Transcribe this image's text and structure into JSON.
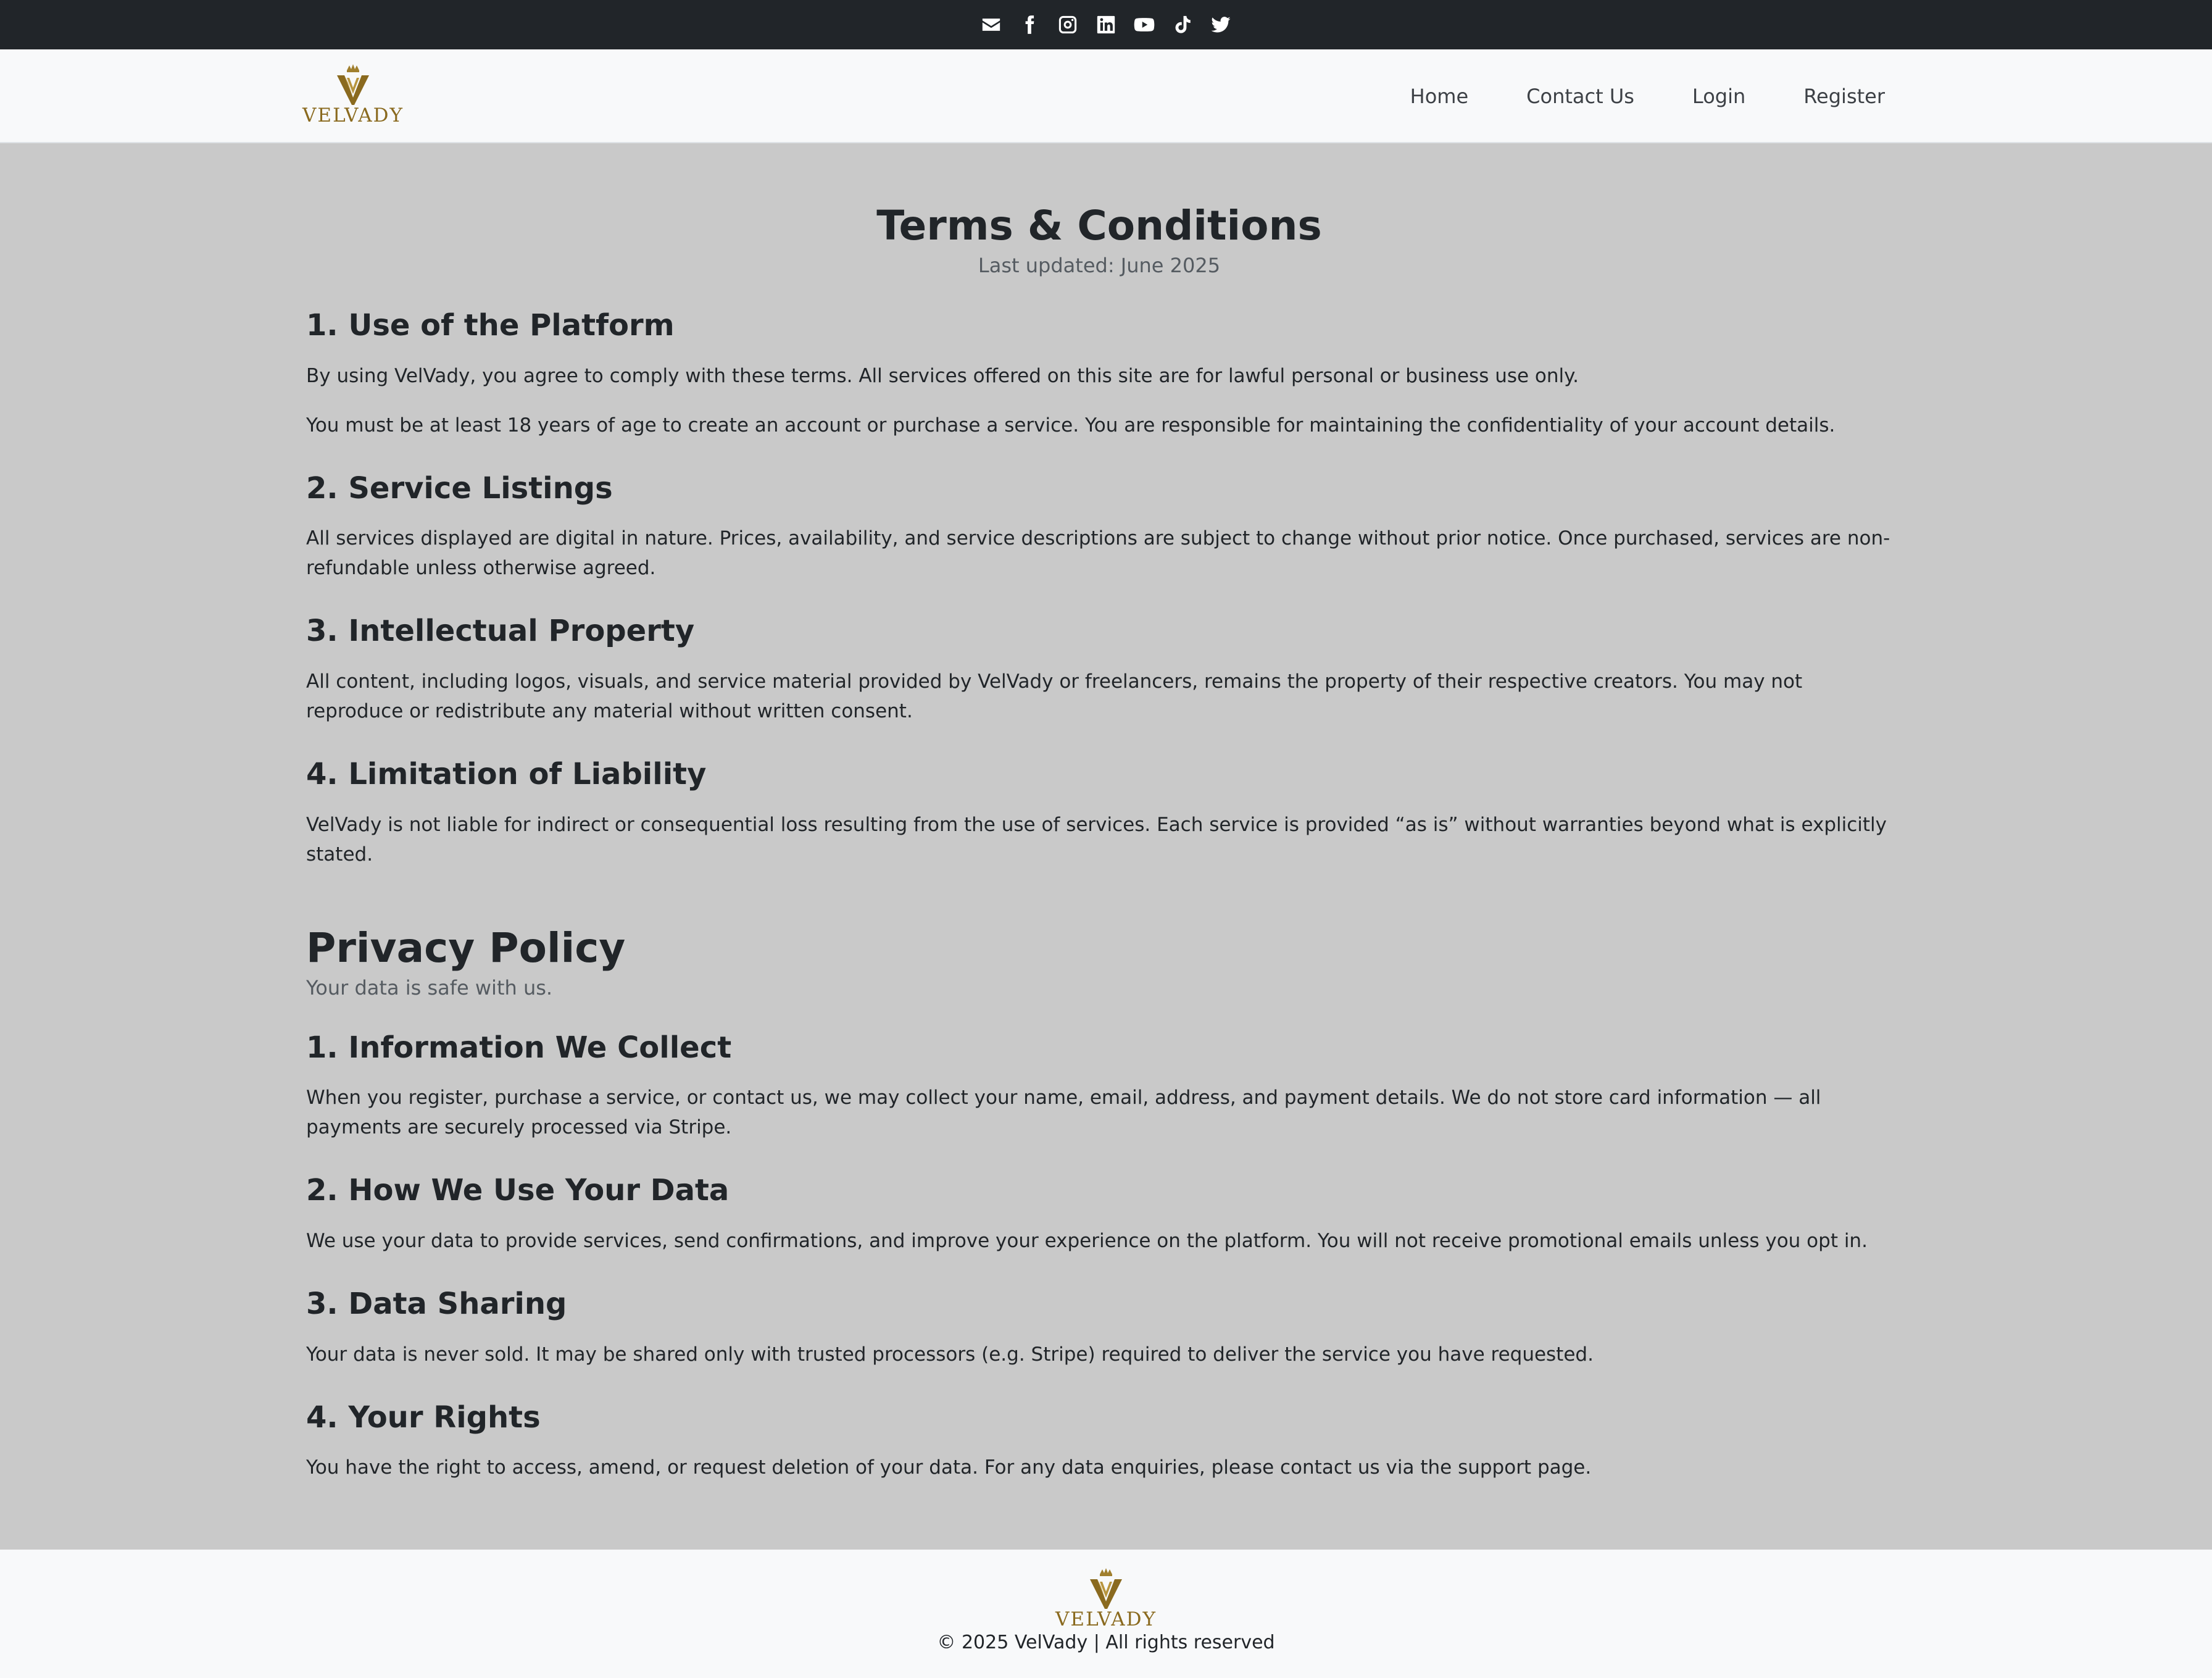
{
  "social": {
    "icons": [
      "envelope-icon",
      "facebook-icon",
      "instagram-icon",
      "linkedin-icon",
      "youtube-icon",
      "tiktok-icon",
      "twitter-icon"
    ]
  },
  "brand": {
    "name": "VELVADY",
    "color": "#8a6a1f"
  },
  "nav": {
    "home": "Home",
    "contact": "Contact Us",
    "login": "Login",
    "register": "Register"
  },
  "terms": {
    "title": "Terms & Conditions",
    "updated": "Last updated: June 2025",
    "sections": [
      {
        "heading": "1. Use of the Platform",
        "paragraphs": [
          "By using VelVady, you agree to comply with these terms. All services offered on this site are for lawful personal or business use only.",
          "You must be at least 18 years of age to create an account or purchase a service. You are responsible for maintaining the confidentiality of your account details."
        ]
      },
      {
        "heading": "2. Service Listings",
        "paragraphs": [
          "All services displayed are digital in nature. Prices, availability, and service descriptions are subject to change without prior notice. Once purchased, services are non-refundable unless otherwise agreed."
        ]
      },
      {
        "heading": "3. Intellectual Property",
        "paragraphs": [
          "All content, including logos, visuals, and service material provided by VelVady or freelancers, remains the property of their respective creators. You may not reproduce or redistribute any material without written consent."
        ]
      },
      {
        "heading": "4. Limitation of Liability",
        "paragraphs": [
          "VelVady is not liable for indirect or consequential loss resulting from the use of services. Each service is provided “as is” without warranties beyond what is explicitly stated."
        ]
      }
    ]
  },
  "privacy": {
    "title": "Privacy Policy",
    "subtitle": "Your data is safe with us.",
    "sections": [
      {
        "heading": "1. Information We Collect",
        "paragraphs": [
          "When you register, purchase a service, or contact us, we may collect your name, email, address, and payment details. We do not store card information — all payments are securely processed via Stripe."
        ]
      },
      {
        "heading": "2. How We Use Your Data",
        "paragraphs": [
          "We use your data to provide services, send confirmations, and improve your experience on the platform. You will not receive promotional emails unless you opt in."
        ]
      },
      {
        "heading": "3. Data Sharing",
        "paragraphs": [
          "Your data is never sold. It may be shared only with trusted processors (e.g. Stripe) required to deliver the service you have requested."
        ]
      },
      {
        "heading": "4. Your Rights",
        "paragraphs": [
          "You have the right to access, amend, or request deletion of your data. For any data enquiries, please contact us via the support page."
        ]
      }
    ]
  },
  "footer": {
    "copyright": "© 2025 VelVady | All rights reserved"
  }
}
